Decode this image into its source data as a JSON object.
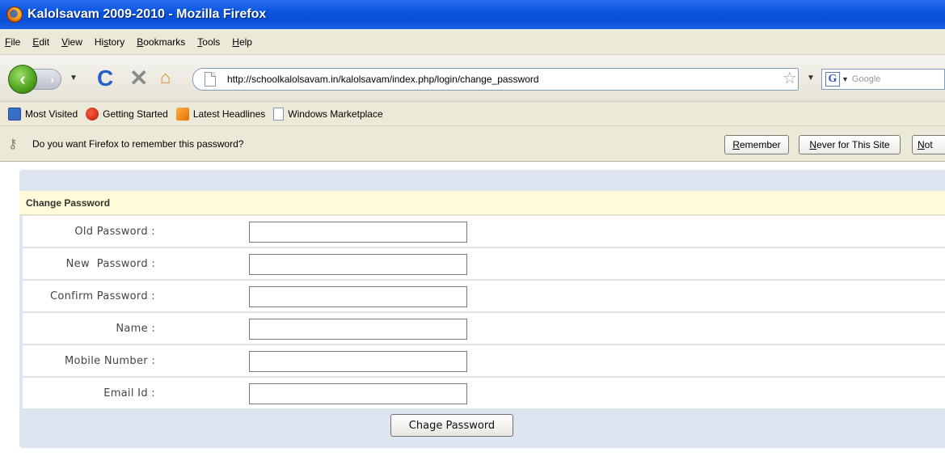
{
  "window": {
    "title": "Kalolsavam 2009-2010 - Mozilla Firefox"
  },
  "menu": [
    {
      "u": "F",
      "rest": "ile"
    },
    {
      "u": "E",
      "rest": "dit"
    },
    {
      "u": "V",
      "rest": "iew"
    },
    {
      "pre": "Hi",
      "u": "s",
      "rest": "tory"
    },
    {
      "u": "B",
      "rest": "ookmarks"
    },
    {
      "u": "T",
      "rest": "ools"
    },
    {
      "u": "H",
      "rest": "elp"
    }
  ],
  "toolbar": {
    "url": "http://schoolkalolsavam.in/kalolsavam/index.php/login/change_password",
    "search_placeholder": "Google"
  },
  "bookmarks": [
    {
      "label": "Most Visited",
      "icon": "most-visited-icon"
    },
    {
      "label": "Getting Started",
      "icon": "getting-started-icon"
    },
    {
      "label": "Latest Headlines",
      "icon": "rss-icon"
    },
    {
      "label": "Windows Marketplace",
      "icon": "page-icon"
    }
  ],
  "notification": {
    "message": "Do you want Firefox to remember this password?",
    "remember": {
      "u": "R",
      "rest": "emember"
    },
    "never": {
      "u": "N",
      "rest": "ever for This Site"
    },
    "not_now": {
      "u": "N",
      "rest": "ot"
    }
  },
  "form": {
    "title": "Change Password",
    "fields": [
      {
        "label": "Old Password :",
        "value": ""
      },
      {
        "label": "New  Password :",
        "value": ""
      },
      {
        "label": "Confirm Password :",
        "value": ""
      },
      {
        "label": "Name :",
        "value": ""
      },
      {
        "label": "Mobile Number :",
        "value": ""
      },
      {
        "label": "Email Id :",
        "value": ""
      }
    ],
    "submit_label": "Chage Password"
  }
}
